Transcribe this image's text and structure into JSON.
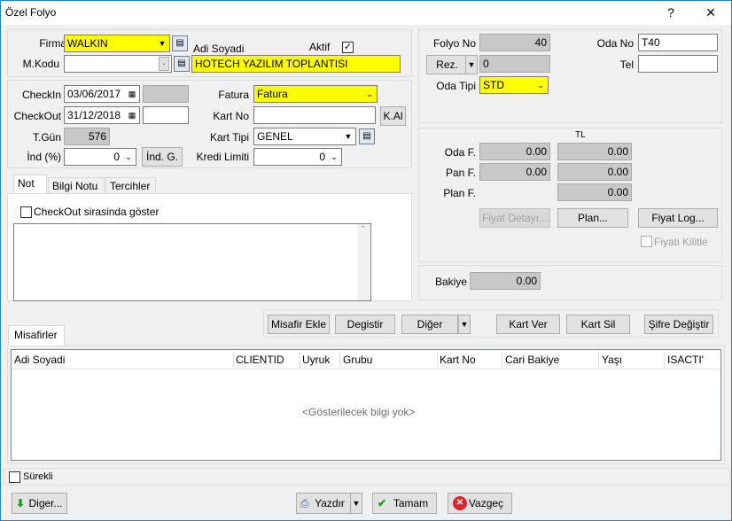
{
  "window": {
    "title": "Özel Folyo",
    "help": "?",
    "close": "✕"
  },
  "left": {
    "firma_label": "Firma",
    "firma_value": "WALKIN",
    "mkodu_label": "M.Kodu",
    "mkodu_value": "",
    "mkodu_dot": ".",
    "adi_soyadi_label": "Adi Soyadi",
    "adi_soyadi_value": "HOTECH YAZILIM TOPLANTISI",
    "aktif_label": "Aktif",
    "aktif_checked": "✓",
    "checkin_label": "CheckIn",
    "checkin_value": "03/06/2017",
    "checkout_label": "CheckOut",
    "checkout_value": "31/12/2018",
    "tgun_label": "T.Gün",
    "tgun_value": "576",
    "ind_label": "İnd (%)",
    "ind_value": "0",
    "ind_g_button": "İnd. G.",
    "fatura_label": "Fatura",
    "fatura_value": "Fatura",
    "kartno_label": "Kart No",
    "kartno_value": "",
    "kal_button": "K.Al",
    "karttipi_label": "Kart Tipi",
    "karttipi_value": "GENEL",
    "kredilimiti_label": "Kredi Limiti",
    "kredilimiti_value": "0"
  },
  "tabs": {
    "items": [
      "Not",
      "Bilgi Notu",
      "Tercihler"
    ],
    "checkout_show_label": "CheckOut sirasinda göster"
  },
  "right": {
    "folyono_label": "Folyo No",
    "folyono_value": "40",
    "odano_label": "Oda No",
    "odano_value": "T40",
    "rez_button": "Rez.",
    "rez_value": "0",
    "tel_label": "Tel",
    "tel_value": "",
    "odatipi_label": "Oda Tipi",
    "odatipi_value": "STD",
    "currency": "TL",
    "odaf_label": "Oda F.",
    "odaf_value1": "0.00",
    "odaf_value2": "0.00",
    "panf_label": "Pan F.",
    "panf_value1": "0.00",
    "panf_value2": "0.00",
    "planf_label": "Plan F.",
    "planf_value": "0.00",
    "fiyat_detayi_button": "Fiyat Detayı...",
    "plan_button": "Plan...",
    "fiyat_log_button": "Fiyat Log...",
    "fiyati_kilitle_label": "Fiyati Kilitle",
    "bakiye_label": "Bakiye",
    "bakiye_value": "0.00"
  },
  "actions": {
    "misafir_ekle": "Misafir Ekle",
    "degistir": "Degistir",
    "diger": "Diğer",
    "kart_ver": "Kart Ver",
    "kart_sil": "Kart Sil",
    "sifre_degistir": "Şifre Değiştir"
  },
  "guests": {
    "tab": "Misafirler",
    "columns": [
      "Adi Soyadi",
      "CLIENTID",
      "Uyruk",
      "Grubu",
      "Kart No",
      "Cari Bakiye",
      "Yaşı",
      "ISACTI'"
    ],
    "empty_text": "<Gösterilecek bilgi yok>"
  },
  "footer": {
    "surekli_label": "Sürekli",
    "diger_button": "Diger...",
    "yazdir_button": "Yazdır",
    "tamam_button": "Tamam",
    "vazgec_button": "Vazgeç"
  },
  "colors": {
    "highlight": "#ffff00",
    "readonly_gray": "#c8c8c8",
    "accent": "#1883d7"
  }
}
